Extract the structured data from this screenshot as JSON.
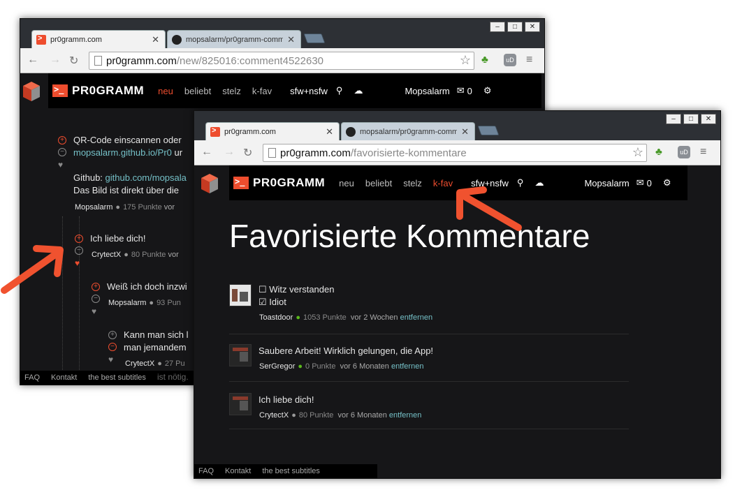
{
  "back_window": {
    "tabs": [
      {
        "label": "pr0gramm.com",
        "active": true,
        "favicon": "pr0gramm-favicon"
      },
      {
        "label": "mopsalarm/pr0gramm-comme",
        "active": false,
        "favicon": "github-favicon"
      }
    ],
    "url": {
      "host": "pr0gramm.com",
      "path": "/new/825016:comment4522630"
    },
    "header": {
      "logo": "PR0GRAMM",
      "nav": [
        "neu",
        "beliebt",
        "stelz",
        "k-fav"
      ],
      "active_nav": "neu",
      "filter": "sfw+nsfw",
      "user": "Mopsalarm",
      "inbox_count": "0"
    },
    "comments": [
      {
        "line1": "QR-Code einscannen oder",
        "link": "mopsalarm.github.io/Pr0",
        "after_link": " ur",
        "github_label": "Github: ",
        "github_link": "github.com/mopsala",
        "line3": "Das Bild ist direkt über die",
        "user": "Mopsalarm",
        "points": "175 Punkte",
        "time": "vor"
      },
      {
        "text": "Ich liebe dich!",
        "user": "CrytectX",
        "points": "80 Punkte",
        "time": "vor"
      },
      {
        "text": "Weiß ich doch inzwi",
        "user": "Mopsalarm",
        "points": "93 Pun"
      },
      {
        "text1": "Kann man sich l",
        "text2": "man jemandem",
        "user": "CrytectX",
        "points": "27 Pu"
      }
    ],
    "footer": {
      "faq": "FAQ",
      "kontakt": "Kontakt",
      "subtitles": "the best subtitles",
      "overlap": "ist nötig."
    }
  },
  "front_window": {
    "tabs": [
      {
        "label": "pr0gramm.com",
        "active": true,
        "favicon": "pr0gramm-favicon"
      },
      {
        "label": "mopsalarm/pr0gramm-comme",
        "active": false,
        "favicon": "github-favicon"
      }
    ],
    "url": {
      "host": "pr0gramm.com",
      "path": "/favorisierte-kommentare"
    },
    "header": {
      "logo": "PR0GRAMM",
      "nav": [
        "neu",
        "beliebt",
        "stelz",
        "k-fav"
      ],
      "active_nav": "k-fav",
      "filter": "sfw+nsfw",
      "user": "Mopsalarm",
      "inbox_count": "0"
    },
    "title": "Favorisierte Kommentare",
    "favorites": [
      {
        "lines": [
          "☐ Witz verstanden",
          "☑ Idiot"
        ],
        "user": "Toastdoor",
        "points": "1053 Punkte",
        "time": "vor 2 Wochen",
        "remove": "entfernen"
      },
      {
        "lines": [
          "Saubere Arbeit! Wirklich gelungen, die App!"
        ],
        "user": "SerGregor",
        "points": "0 Punkte",
        "time": "vor 6 Monaten",
        "remove": "entfernen"
      },
      {
        "lines": [
          "Ich liebe dich!"
        ],
        "user": "CrytectX",
        "points": "80 Punkte",
        "time": "vor 6 Monaten",
        "remove": "entfernen"
      }
    ],
    "footer": {
      "faq": "FAQ",
      "kontakt": "Kontakt",
      "subtitles": "the best subtitles"
    }
  },
  "colors": {
    "accent": "#ee4d2e",
    "link": "#75c0c7",
    "background": "#161618",
    "arrow": "#f0522f"
  },
  "window_controls": [
    "minimize",
    "maximize",
    "close"
  ]
}
